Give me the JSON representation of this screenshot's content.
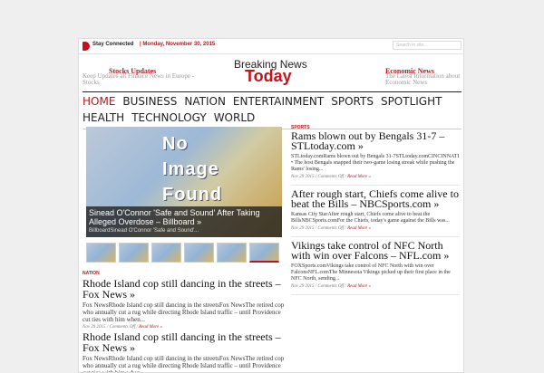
{
  "topbar": {
    "stay_connected": "Stay Connected",
    "date": "| Monday, November 30, 2015",
    "search_placeholder": "Search in site..."
  },
  "header": {
    "left_title": "Stocks Updates",
    "left_sub": "Keep Updates all Finance News in Europe - Stocks",
    "brand_line1": "Breaking News",
    "brand_line2": "Today",
    "right_title": "Economic News",
    "right_sub": "The Latest Information about Economic News"
  },
  "nav": {
    "items": [
      "HOME",
      "BUSINESS",
      "NATION",
      "ENTERTAINMENT",
      "SPORTS",
      "SPOTLIGHT",
      "HEALTH",
      "TECHNOLOGY",
      "WORLD"
    ]
  },
  "feature": {
    "placeholder_words": [
      "No",
      "Image",
      "Found"
    ],
    "title": "Sinead O'Connor 'Safe and Sound' After Taking Alleged Overdose – Billboard »",
    "excerpt": "BillboardSinead O'Connor 'Safe and Sound'..."
  },
  "left": {
    "category": "NATION",
    "articles": [
      {
        "title": "Rhode Island cop still dancing in the streets – Fox News »",
        "excerpt": "Fox NewsRhode Island cop still dancing in the streetsFox NewsThe retired cop who annually cut a rug while directing Rhode Island traffic – until Providence cut ties with him when...",
        "date": "Nov 29 2015",
        "comments": "Comments Off",
        "more": "Read More »"
      },
      {
        "title": "Rhode Island cop still dancing in the streets – Fox News »",
        "excerpt": "Fox NewsRhode Island cop still dancing in the streetsFox NewsThe retired cop who annually cut a rug while directing Rhode Island traffic – until Providence cut ties with him when..."
      }
    ]
  },
  "right": {
    "category": "SPORTS",
    "articles": [
      {
        "title": "Rams blown out by Bengals 31-7 – STLtoday.com »",
        "excerpt": "STLtoday.comRams blown out by Bengals 31-7STLtoday.comCINCINNATI • The host Bengals snapped their two-game losing streak while pushing the Rams' losing...",
        "date": "Nov 29 2015",
        "comments": "Comments Off",
        "more": "Read More »"
      },
      {
        "title": "After rough start, Chiefs come alive to beat the Bills – NBCSports.com »",
        "excerpt": "Kansas City StarAfter rough start, Chiefs come alive to beat the BillsNBCSports.comFor the Chiefs, today's game against the Bills was...",
        "date": "Nov 29 2015",
        "comments": "Comments Off",
        "more": "Read More »"
      },
      {
        "title": "Vikings take control of NFC North with win over Falcons – NFL.com »",
        "excerpt": "FOXSports.comVikings take control of NFC North with win over FalconsNFL.comThe Minnesota Vikings picked up their first place in the NFC North, sending...",
        "date": "Nov 29 2015",
        "comments": "Comments Off",
        "more": "Read More »"
      }
    ]
  },
  "colors": {
    "accent": "#c0141a",
    "text": "#222222",
    "background": "#efefef"
  }
}
